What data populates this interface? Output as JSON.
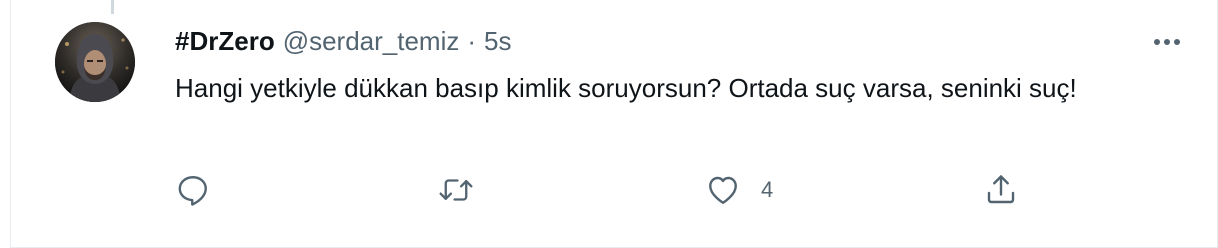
{
  "tweet": {
    "display_name": "#DrZero",
    "handle": "@serdar_temiz",
    "separator": "·",
    "time": "5s",
    "text": "Hangi yetkiyle dükkan basıp kimlik soruyorsun? Ortada suç varsa, seninki suç!"
  },
  "actions": {
    "reply_icon": "reply-icon",
    "retweet_icon": "retweet-icon",
    "like_icon": "heart-icon",
    "like_count": "4",
    "share_icon": "share-icon",
    "more_icon": "more-horizontal-icon"
  },
  "colors": {
    "text_primary": "#0f1419",
    "text_secondary": "#536471",
    "border": "#e6ecf0"
  }
}
